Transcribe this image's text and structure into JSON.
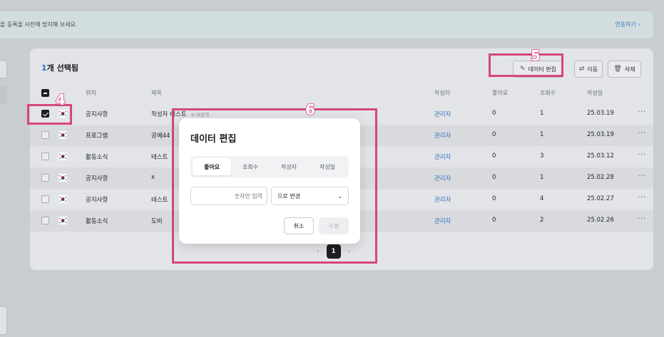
{
  "notice": {
    "text": "을 등록을 사전에 방지해 보세요.",
    "link": "연동하기",
    "link_chevron": "›"
  },
  "toolbar": {
    "selected_count": "1",
    "selected_suffix": "개 선택됨",
    "edit_label": "데이터 편집",
    "edit_icon": "✎",
    "move_label": "이동",
    "move_icon": "⇄",
    "delete_label": "삭제",
    "delete_icon": "🗑"
  },
  "table": {
    "headers": {
      "location": "위치",
      "title": "제목",
      "author": "작성자",
      "likes": "좋아요",
      "views": "조회수",
      "date": "작성일"
    },
    "private_badge": "비공개",
    "rows": [
      {
        "location": "공지사항",
        "title": "작성자 테스트",
        "author": "관리자",
        "likes": "0",
        "views": "1",
        "date": "25.03.19",
        "checked": true,
        "private": true
      },
      {
        "location": "프로그램",
        "title": "공예44",
        "author": "관리자",
        "likes": "0",
        "views": "1",
        "date": "25.03.19",
        "checked": false,
        "private": false
      },
      {
        "location": "활동소식",
        "title": "테스트",
        "author": "관리자",
        "likes": "0",
        "views": "3",
        "date": "25.03.12",
        "checked": false,
        "private": false
      },
      {
        "location": "공지사항",
        "title": "x",
        "author": "관리자",
        "likes": "0",
        "views": "1",
        "date": "25.02.28",
        "checked": false,
        "private": false
      },
      {
        "location": "공지사항",
        "title": "테스트",
        "author": "관리자",
        "likes": "0",
        "views": "4",
        "date": "25.02.27",
        "checked": false,
        "private": false
      },
      {
        "location": "활동소식",
        "title": "도비",
        "author": "관리자",
        "likes": "0",
        "views": "2",
        "date": "25.02.26",
        "checked": false,
        "private": false
      }
    ],
    "more_icon": "···"
  },
  "pagination": {
    "prev": "‹",
    "current": "1",
    "next": "›"
  },
  "modal": {
    "title": "데이터 편집",
    "tabs": [
      "좋아요",
      "조회수",
      "작성자",
      "작성일"
    ],
    "active_tab": "좋아요",
    "number_placeholder": "숫자만 입력",
    "select_value": "으로 변경",
    "select_chevron": "⌄",
    "cancel_label": "취소",
    "submit_label": "수정"
  },
  "annotations": {
    "label_4": "4",
    "label_5": "5",
    "label_6": "6",
    "color": "#d6467a"
  },
  "colors": {
    "accent_blue": "#3a78c0",
    "count_blue": "#2f6fd3"
  }
}
